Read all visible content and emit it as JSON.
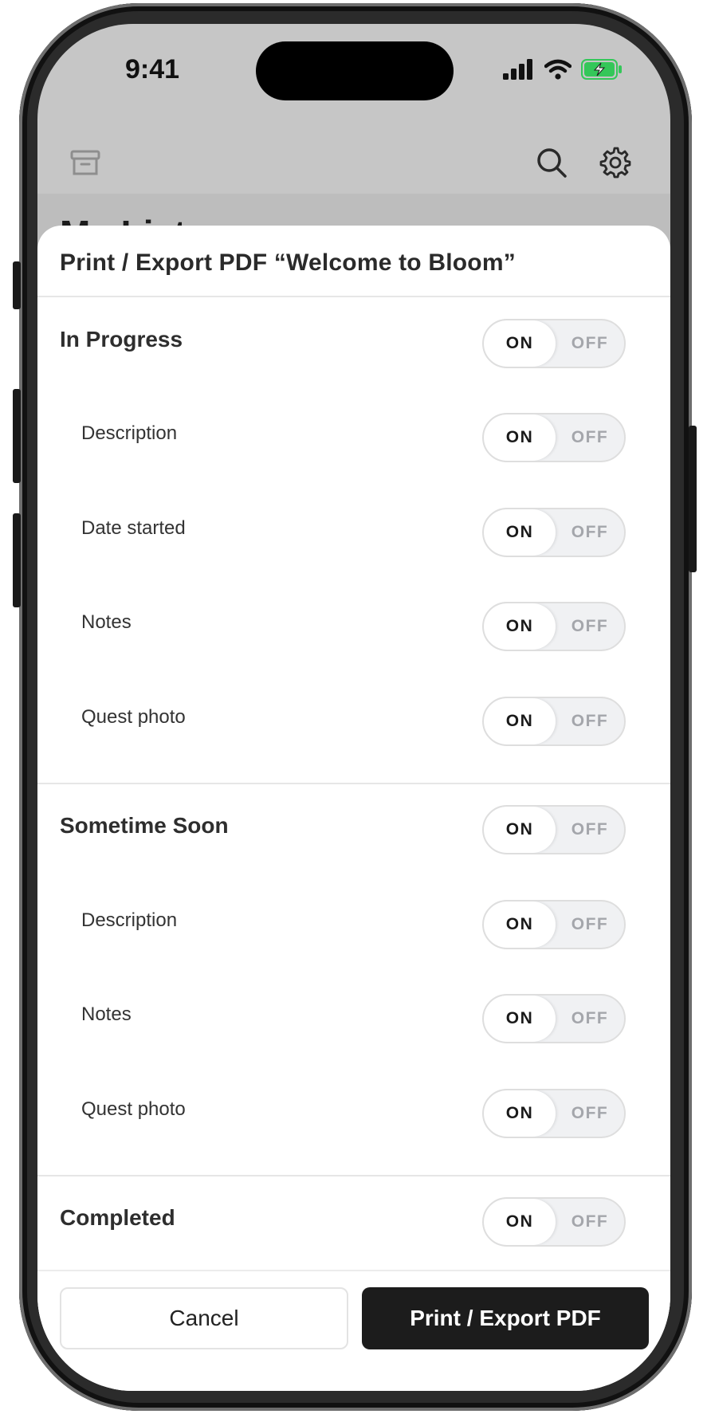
{
  "status_bar": {
    "time": "9:41",
    "icons": [
      "cellular-signal-icon",
      "wifi-icon",
      "battery-charging-icon"
    ],
    "battery_color": "#34c759"
  },
  "toolbar": {
    "icons": [
      "archive-icon",
      "search-icon",
      "settings-gear-icon"
    ]
  },
  "background_title": "My List",
  "sheet": {
    "title": "Print / Export PDF “Welcome to Bloom”",
    "toggle_on_label": "ON",
    "toggle_off_label": "OFF",
    "sections": [
      {
        "label": "In Progress",
        "state": "ON",
        "items": [
          {
            "label": "Description",
            "state": "ON"
          },
          {
            "label": "Date started",
            "state": "ON"
          },
          {
            "label": "Notes",
            "state": "ON"
          },
          {
            "label": "Quest photo",
            "state": "ON"
          }
        ]
      },
      {
        "label": "Sometime Soon",
        "state": "ON",
        "items": [
          {
            "label": "Description",
            "state": "ON"
          },
          {
            "label": "Notes",
            "state": "ON"
          },
          {
            "label": "Quest photo",
            "state": "ON"
          }
        ]
      },
      {
        "label": "Completed",
        "state": "ON",
        "items": []
      }
    ]
  },
  "footer": {
    "cancel_label": "Cancel",
    "print_label": "Print / Export PDF"
  }
}
